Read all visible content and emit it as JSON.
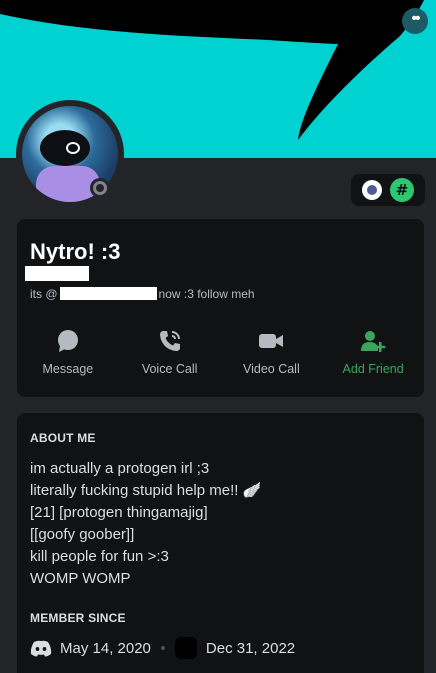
{
  "colors": {
    "banner": "#00d1d1",
    "panel": "#232428",
    "card": "#111214",
    "accent_green": "#3ba55d",
    "text_muted": "#b5bac1"
  },
  "header": {
    "menu_icon": "more-icon"
  },
  "profile": {
    "display_name": "Nytro! :3",
    "tagline_start": "its @",
    "tagline_end": "now :3 follow meh",
    "status": "offline",
    "badges": [
      "speed-badge-icon",
      "hashtag-badge-icon"
    ],
    "hash_glyph": "#"
  },
  "actions": [
    {
      "label": "Message",
      "icon": "chat-bubble-icon"
    },
    {
      "label": "Voice Call",
      "icon": "phone-icon"
    },
    {
      "label": "Video Call",
      "icon": "video-camera-icon"
    },
    {
      "label": "Add Friend",
      "icon": "add-friend-icon"
    }
  ],
  "about": {
    "title": "ABOUT ME",
    "lines": [
      "im actually a protogen irl ;3",
      "literally fucking stupid help me!! 🪽",
      "[21] [protogen thingamajig]",
      "[[goofy goober]]",
      "kill people for fun >:3",
      "WOMP WOMP"
    ]
  },
  "member_since": {
    "title": "MEMBER SINCE",
    "discord_date": "May 14, 2020",
    "server_date": "Dec 31, 2022"
  }
}
